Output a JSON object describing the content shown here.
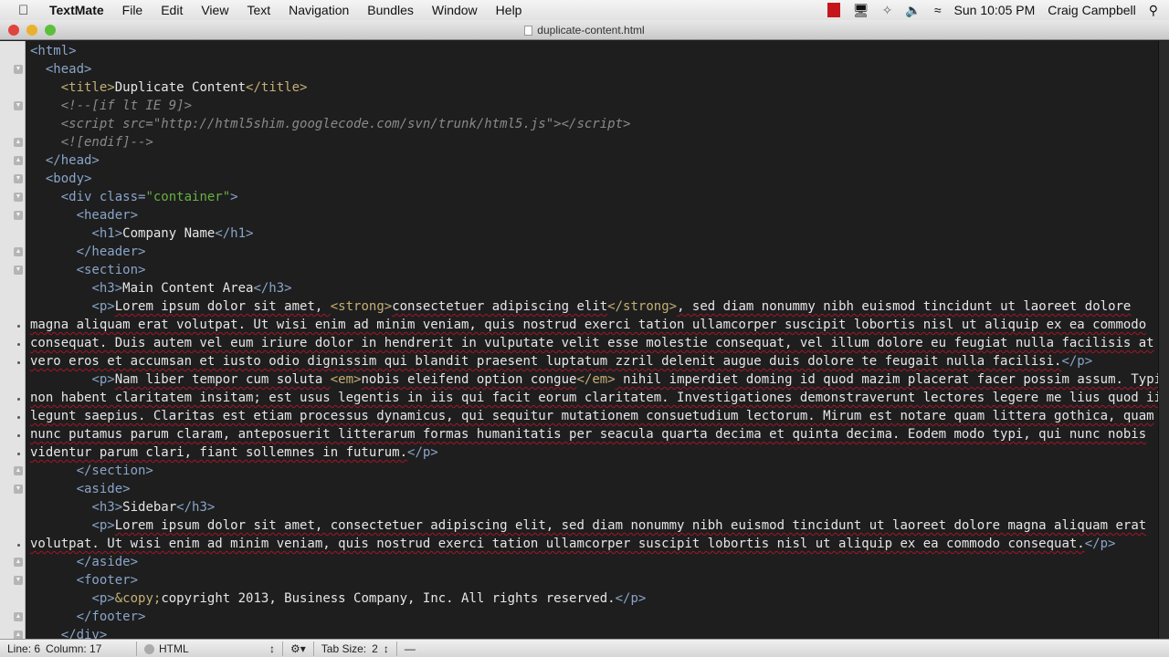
{
  "menubar": {
    "app": "TextMate",
    "items": [
      "File",
      "Edit",
      "View",
      "Text",
      "Navigation",
      "Bundles",
      "Window",
      "Help"
    ],
    "clock": "Sun 10:05 PM",
    "user": "Craig Campbell"
  },
  "window": {
    "title": "duplicate-content.html"
  },
  "editor": {
    "rows": [
      {
        "fold": "",
        "segs": [
          [
            "tag",
            "<html>"
          ]
        ]
      },
      {
        "fold": "down",
        "segs": [
          [
            "",
            "  "
          ],
          [
            "tag",
            "<head>"
          ]
        ]
      },
      {
        "fold": "",
        "segs": [
          [
            "",
            "    "
          ],
          [
            "ttag",
            "<title>"
          ],
          [
            "",
            "Duplicate Content"
          ],
          [
            "ttag",
            "</title>"
          ]
        ]
      },
      {
        "fold": "down",
        "segs": [
          [
            "",
            "    "
          ],
          [
            "cm",
            "<!--[if lt IE 9]>"
          ]
        ]
      },
      {
        "fold": "",
        "segs": [
          [
            "",
            "    "
          ],
          [
            "cm",
            "<script src=\"http://html5shim.googlecode.com/svn/trunk/html5.js\"></script>"
          ]
        ]
      },
      {
        "fold": "up",
        "segs": [
          [
            "",
            "    "
          ],
          [
            "cm",
            "<![endif]-->"
          ]
        ]
      },
      {
        "fold": "up",
        "segs": [
          [
            "",
            "  "
          ],
          [
            "tag",
            "</head>"
          ]
        ]
      },
      {
        "fold": "down",
        "segs": [
          [
            "",
            "  "
          ],
          [
            "tag",
            "<body>"
          ]
        ]
      },
      {
        "fold": "down",
        "segs": [
          [
            "",
            "    "
          ],
          [
            "tag",
            "<div class="
          ],
          [
            "str",
            "\"container\""
          ],
          [
            "tag",
            ">"
          ]
        ]
      },
      {
        "fold": "down",
        "segs": [
          [
            "",
            "      "
          ],
          [
            "tag",
            "<header>"
          ]
        ]
      },
      {
        "fold": "",
        "segs": [
          [
            "",
            "        "
          ],
          [
            "tag",
            "<h1>"
          ],
          [
            "",
            "Company Name"
          ],
          [
            "tag",
            "</h1>"
          ]
        ]
      },
      {
        "fold": "up",
        "segs": [
          [
            "",
            "      "
          ],
          [
            "tag",
            "</header>"
          ]
        ]
      },
      {
        "fold": "down",
        "segs": [
          [
            "",
            "      "
          ],
          [
            "tag",
            "<section>"
          ]
        ]
      },
      {
        "fold": "",
        "segs": [
          [
            "",
            "        "
          ],
          [
            "tag",
            "<h3>"
          ],
          [
            "",
            "Main Content Area"
          ],
          [
            "tag",
            "</h3>"
          ]
        ]
      },
      {
        "fold": "",
        "segs": [
          [
            "",
            "        "
          ],
          [
            "tag",
            "<p>"
          ],
          [
            "sp",
            "Lorem ipsum dolor sit amet, "
          ],
          [
            "ttag",
            "<strong>"
          ],
          [
            "sp",
            "consectetuer adipiscing elit"
          ],
          [
            "ttag",
            "</strong>"
          ],
          [
            "sp",
            ", sed diam nonummy nibh euismod tincidunt ut laoreet dolore"
          ]
        ]
      },
      {
        "fold": "wrap",
        "segs": [
          [
            "sp",
            "magna aliquam erat volutpat. Ut wisi enim ad minim veniam, quis nostrud exerci tation ullamcorper suscipit lobortis nisl ut aliquip ex ea commodo"
          ]
        ]
      },
      {
        "fold": "wrap",
        "segs": [
          [
            "sp",
            "consequat. Duis autem vel eum iriure dolor in hendrerit in vulputate velit esse molestie consequat, vel illum dolore eu feugiat nulla facilisis at"
          ]
        ]
      },
      {
        "fold": "wrap",
        "segs": [
          [
            "sp",
            "vero eros et accumsan et iusto odio dignissim qui blandit praesent luptatum zzril delenit augue duis dolore te feugait nulla facilisi."
          ],
          [
            "tag",
            "</p>"
          ]
        ]
      },
      {
        "fold": "",
        "segs": [
          [
            "",
            "        "
          ],
          [
            "tag",
            "<p>"
          ],
          [
            "sp",
            "Nam liber tempor cum soluta "
          ],
          [
            "ttag",
            "<em>"
          ],
          [
            "sp",
            "nobis eleifend option congue"
          ],
          [
            "ttag",
            "</em>"
          ],
          [
            "sp",
            " nihil imperdiet doming id quod mazim placerat facer possim assum. Typi"
          ]
        ]
      },
      {
        "fold": "wrap",
        "segs": [
          [
            "sp",
            "non habent claritatem insitam; est usus legentis in iis qui facit eorum claritatem. Investigationes demonstraverunt lectores legere me lius quod ii"
          ]
        ]
      },
      {
        "fold": "wrap",
        "segs": [
          [
            "sp",
            "legunt saepius. Claritas est etiam processus dynamicus, qui sequitur mutationem consuetudium lectorum. Mirum est notare quam littera gothica, quam"
          ]
        ]
      },
      {
        "fold": "wrap",
        "segs": [
          [
            "sp",
            "nunc putamus parum claram, anteposuerit litterarum formas humanitatis per seacula quarta decima et quinta decima. Eodem modo typi, qui nunc nobis"
          ]
        ]
      },
      {
        "fold": "wrap",
        "segs": [
          [
            "sp",
            "videntur parum clari, fiant sollemnes in futurum."
          ],
          [
            "tag",
            "</p>"
          ]
        ]
      },
      {
        "fold": "up",
        "segs": [
          [
            "",
            "      "
          ],
          [
            "tag",
            "</section>"
          ]
        ]
      },
      {
        "fold": "down",
        "segs": [
          [
            "",
            "      "
          ],
          [
            "tag",
            "<aside>"
          ]
        ]
      },
      {
        "fold": "",
        "segs": [
          [
            "",
            "        "
          ],
          [
            "tag",
            "<h3>"
          ],
          [
            "",
            "Sidebar"
          ],
          [
            "tag",
            "</h3>"
          ]
        ]
      },
      {
        "fold": "",
        "segs": [
          [
            "",
            "        "
          ],
          [
            "tag",
            "<p>"
          ],
          [
            "sp",
            "Lorem ipsum dolor sit amet, consectetuer adipiscing elit, sed diam nonummy nibh euismod tincidunt ut laoreet dolore magna aliquam erat"
          ]
        ]
      },
      {
        "fold": "wrap",
        "segs": [
          [
            "sp",
            "volutpat. Ut wisi enim ad minim veniam, quis nostrud exerci tation ullamcorper suscipit lobortis nisl ut aliquip ex ea commodo consequat."
          ],
          [
            "tag",
            "</p>"
          ]
        ]
      },
      {
        "fold": "up",
        "segs": [
          [
            "",
            "      "
          ],
          [
            "tag",
            "</aside>"
          ]
        ]
      },
      {
        "fold": "down",
        "segs": [
          [
            "",
            "      "
          ],
          [
            "tag",
            "<footer>"
          ]
        ]
      },
      {
        "fold": "",
        "segs": [
          [
            "",
            "        "
          ],
          [
            "tag",
            "<p>"
          ],
          [
            "ttag",
            "&copy;"
          ],
          [
            "",
            "copyright 2013, Business Company, Inc. All rights reserved."
          ],
          [
            "tag",
            "</p>"
          ]
        ]
      },
      {
        "fold": "up",
        "segs": [
          [
            "",
            "      "
          ],
          [
            "tag",
            "</footer>"
          ]
        ]
      },
      {
        "fold": "up",
        "segs": [
          [
            "",
            "    "
          ],
          [
            "tag",
            "</div>"
          ]
        ]
      }
    ]
  },
  "statusbar": {
    "line": "Line: 6",
    "column": "Column: 17",
    "language": "HTML",
    "tab_size_label": "Tab Size:",
    "tab_size": "2",
    "symbol": "—"
  }
}
